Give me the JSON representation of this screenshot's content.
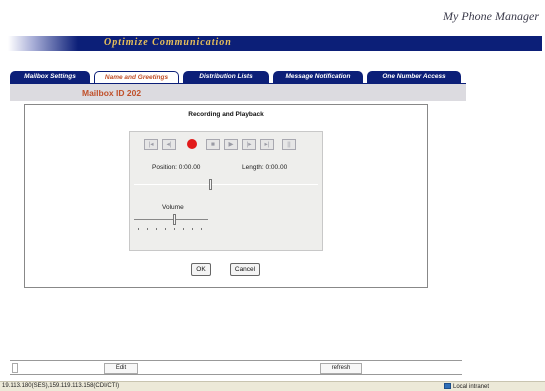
{
  "app": {
    "title": "My Phone Manager"
  },
  "banner": {
    "text": "Optimize Communication"
  },
  "tabs": [
    {
      "label": "Mailbox Settings",
      "active": false
    },
    {
      "label": "Name and Greetings",
      "active": true
    },
    {
      "label": "Distribution Lists",
      "active": false
    },
    {
      "label": "Message Notification",
      "active": false
    },
    {
      "label": "One Number Access",
      "active": false
    }
  ],
  "mailbox": {
    "label": "Mailbox ID 202"
  },
  "recorder": {
    "title": "Recording and Playback",
    "position_label": "Position: 0:00.00",
    "length_label": "Length: 0:00.00",
    "volume_label": "Volume",
    "position_fraction": 0.42,
    "volume_fraction": 0.55,
    "controls": [
      {
        "icon": "skip-to-start-icon",
        "glyph": "|◂",
        "enabled": false
      },
      {
        "icon": "step-back-icon",
        "glyph": "◂|",
        "enabled": false
      },
      {
        "icon": "record-icon",
        "glyph": "",
        "enabled": true
      },
      {
        "icon": "stop-icon",
        "glyph": "■",
        "enabled": false
      },
      {
        "icon": "play-icon",
        "glyph": "▶",
        "enabled": false
      },
      {
        "icon": "step-forward-icon",
        "glyph": "|▸",
        "enabled": false
      },
      {
        "icon": "skip-to-end-icon",
        "glyph": "▸|",
        "enabled": false
      },
      {
        "icon": "pause-icon",
        "glyph": "||",
        "enabled": false
      }
    ]
  },
  "dialog": {
    "ok_label": "OK",
    "cancel_label": "Cancel"
  },
  "bottom": {
    "edit_label": "Edit",
    "refresh_label": "refresh"
  },
  "status": {
    "text": "19.113.180(SES),159.119.113.158(CDI/CTI)",
    "zone": "Local intranet"
  },
  "colors": {
    "banner": "#0c1f78",
    "accent": "#c0502a",
    "record": "#e21a1a"
  }
}
